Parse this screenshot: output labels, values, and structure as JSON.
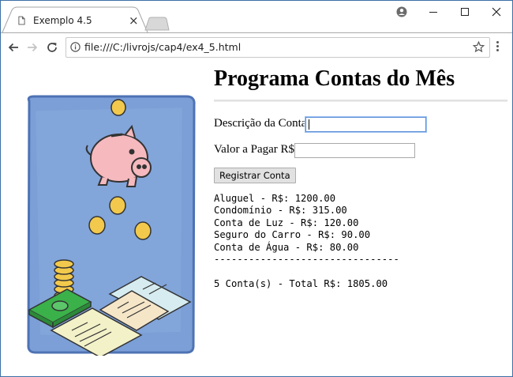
{
  "browser": {
    "tab_title": "Exemplo 4.5",
    "tab_close": "×",
    "url": "file:///C:/livrojs/cap4/ex4_5.html"
  },
  "page": {
    "title": "Programa Contas do Mês",
    "form": {
      "descricao_label": "Descrição da Conta:",
      "descricao_value": "",
      "valor_label": "Valor a Pagar R$:",
      "valor_value": "",
      "button_label": "Registrar Conta"
    },
    "output": {
      "lines": [
        "Aluguel - R$: 1200.00",
        "Condomínio - R$: 315.00",
        "Conta de Luz - R$: 120.00",
        "Seguro do Carro - R$: 90.00",
        "Conta de Água - R$: 80.00",
        "--------------------------------",
        "",
        "5 Conta(s) - Total R$: 1805.00"
      ]
    }
  },
  "colors": {
    "illustration_bg": "#7b9fd6",
    "piggy": "#f5b9be",
    "coin": "#f2c94c",
    "money": "#3bb14a"
  }
}
